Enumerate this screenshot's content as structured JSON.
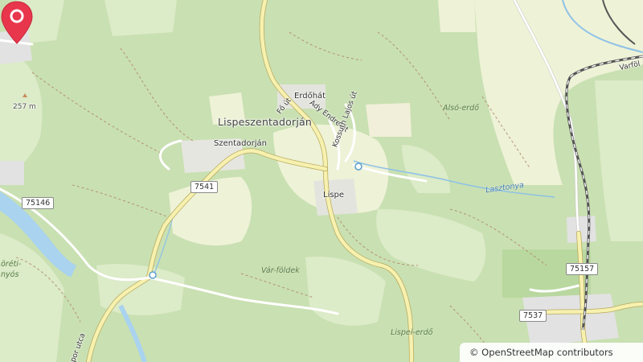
{
  "map": {
    "places": {
      "lispeszentadorjan": "Lispeszentadorján",
      "szentadorjan": "Szentadorján",
      "erdohat": "Erdőhát",
      "lispe": "Lispe"
    },
    "forests": {
      "also_erdo": "Alsó-erdő",
      "var_foldek": "Vár-földek",
      "lispei_erdo": "Lispei-erdő",
      "horeti_nyos": "öréti-\nnyós"
    },
    "streets": {
      "fo_ut": "Fő út",
      "ady_endre": "Ady Endre út",
      "kossuth_lajos": "Kossuth Lajos út",
      "kossuth_partial": "por utca",
      "varfold": "Varföl"
    },
    "water": {
      "lasztonya": "Lasztonya"
    },
    "road_numbers": {
      "r7541": "7541",
      "r75146": "75146",
      "r75157": "75157",
      "r7537": "7537"
    },
    "elevation": "257 m",
    "marker_icon": "location-pin-icon",
    "colors": {
      "forest": "#c9e0b2",
      "meadow": "#eef2d7",
      "road": "#ffffff",
      "main_road": "#f7f1b0",
      "railway": "#555555",
      "water": "#a9d3ee",
      "residential": "#e4e4e4",
      "marker": "#e8364d"
    }
  },
  "attribution": {
    "symbol": "©",
    "text": "OpenStreetMap contributors"
  }
}
